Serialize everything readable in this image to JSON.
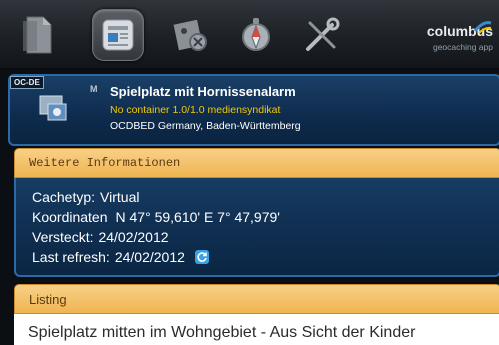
{
  "toolbar": {
    "buttons": [
      {
        "icon": "document-icon"
      },
      {
        "icon": "cache-details-icon",
        "active": true
      },
      {
        "icon": "map-tools-icon"
      },
      {
        "icon": "compass-icon"
      },
      {
        "icon": "settings-tools-icon"
      }
    ],
    "brand_name": "columbus",
    "brand_sub": "geocaching app"
  },
  "cache": {
    "badge": "OC-DE",
    "marker": "M",
    "title": "Spielplatz mit Hornissenalarm",
    "details": "No container  1.0/1.0  mediensyndikat",
    "location": "OCDBED Germany, Baden-Württemberg"
  },
  "info_section": {
    "header": "Weitere Informationen",
    "rows": [
      {
        "label": "Cachetyp:",
        "value": "Virtual"
      },
      {
        "label": "Koordinaten",
        "value": "N 47° 59,610' E 7° 47,979'"
      },
      {
        "label": "Versteckt:",
        "value": "24/02/2012"
      },
      {
        "label": "Last refresh:",
        "value": "24/02/2012"
      }
    ]
  },
  "listing_section": {
    "header": "Listing",
    "text": "Spielplatz mitten im Wohngebiet - Aus Sicht der Kinder"
  },
  "colors": {
    "accent_orange": "#f0b552",
    "panel_blue": "#0f2e50",
    "panel_border": "#2b6aa6",
    "detail_yellow": "#f3c800"
  }
}
